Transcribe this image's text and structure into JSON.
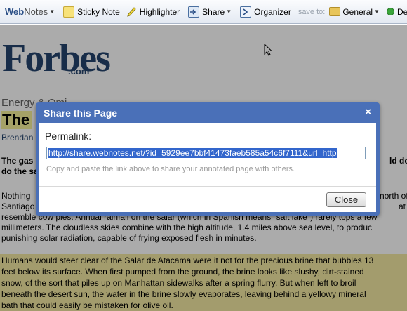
{
  "toolbar": {
    "brand_web": "Web",
    "brand_notes": "Notes",
    "sticky_note": "Sticky Note",
    "highlighter": "Highlighter",
    "share": "Share",
    "organizer": "Organizer",
    "save_to": "save to:",
    "general": "General",
    "de": "De"
  },
  "page": {
    "logo": "Forbes",
    "logo_com": ".com",
    "category": "Energy & Omi",
    "headline": "The",
    "byline": "Brendan",
    "deck_line1": "The gas",
    "deck_line2": "do the sam",
    "deck_right": "ld do",
    "p1": [
      "Nothing",
      "Santiago",
      "resemble cow pies. Annual rainfall on the salar (which in Spanish means \"salt lake\") rarely tops a few",
      "millimeters. The cloudless skies combine with the high altitude, 1.4 miles above sea level, to produc",
      "punishing solar radiation, capable of frying exposed flesh in minutes."
    ],
    "p1_right": [
      "north of",
      "at"
    ],
    "p2": [
      "Humans would steer clear of the Salar de Atacama were it not for the precious brine that bubbles 13",
      "feet below its surface. When first pumped from the ground, the brine looks like slushy, dirt-stained",
      "snow, of the sort that piles up on Manhattan sidewalks after a spring flurry. But when left to broil",
      "beneath the desert sun, the water in the brine slowly evaporates, leaving behind a yellowy mineral",
      "bath that could easily be mistaken for olive oil."
    ]
  },
  "dialog": {
    "title": "Share this Page",
    "close_icon": "×",
    "permalink_label": "Permalink:",
    "permalink_value": "http://share.webnotes.net/?id=5929ee7bbf41473faeb585a54c6f7111&url=http",
    "hint": "Copy and paste the link above to share your annotated page with others.",
    "close_button": "Close"
  }
}
